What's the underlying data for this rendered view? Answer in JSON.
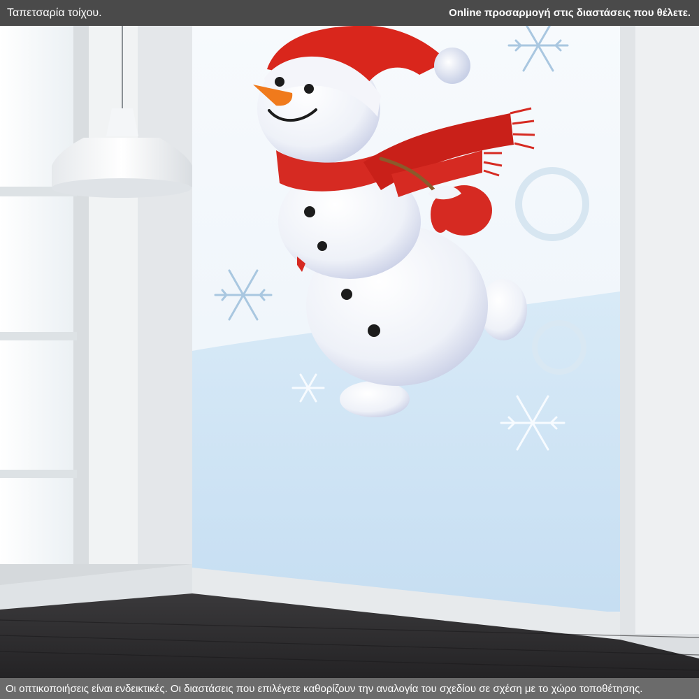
{
  "header": {
    "product_title": "Ταπετσαρία τοίχου.",
    "info": "Online προσαρμογή στις διαστάσεις που θέλετε."
  },
  "footer": {
    "disclaimer": "Οι οπτικοποιήσεις είναι ενδεικτικές. Οι διαστάσεις που επιλέγετε καθορίζουν την αναλογία του σχεδίου σε σχέση με το χώρο τοποθέτησης."
  },
  "scene": {
    "subject": "snowman-wallpaper",
    "colors": {
      "scarf": "#d62a22",
      "hat": "#d9261c",
      "carrot": "#f07a1c",
      "floor": "#2e2c2e",
      "wall": "#eef0f2",
      "snow_sky": "#f3f7fb",
      "snow_ground": "#cfe4f4"
    }
  }
}
